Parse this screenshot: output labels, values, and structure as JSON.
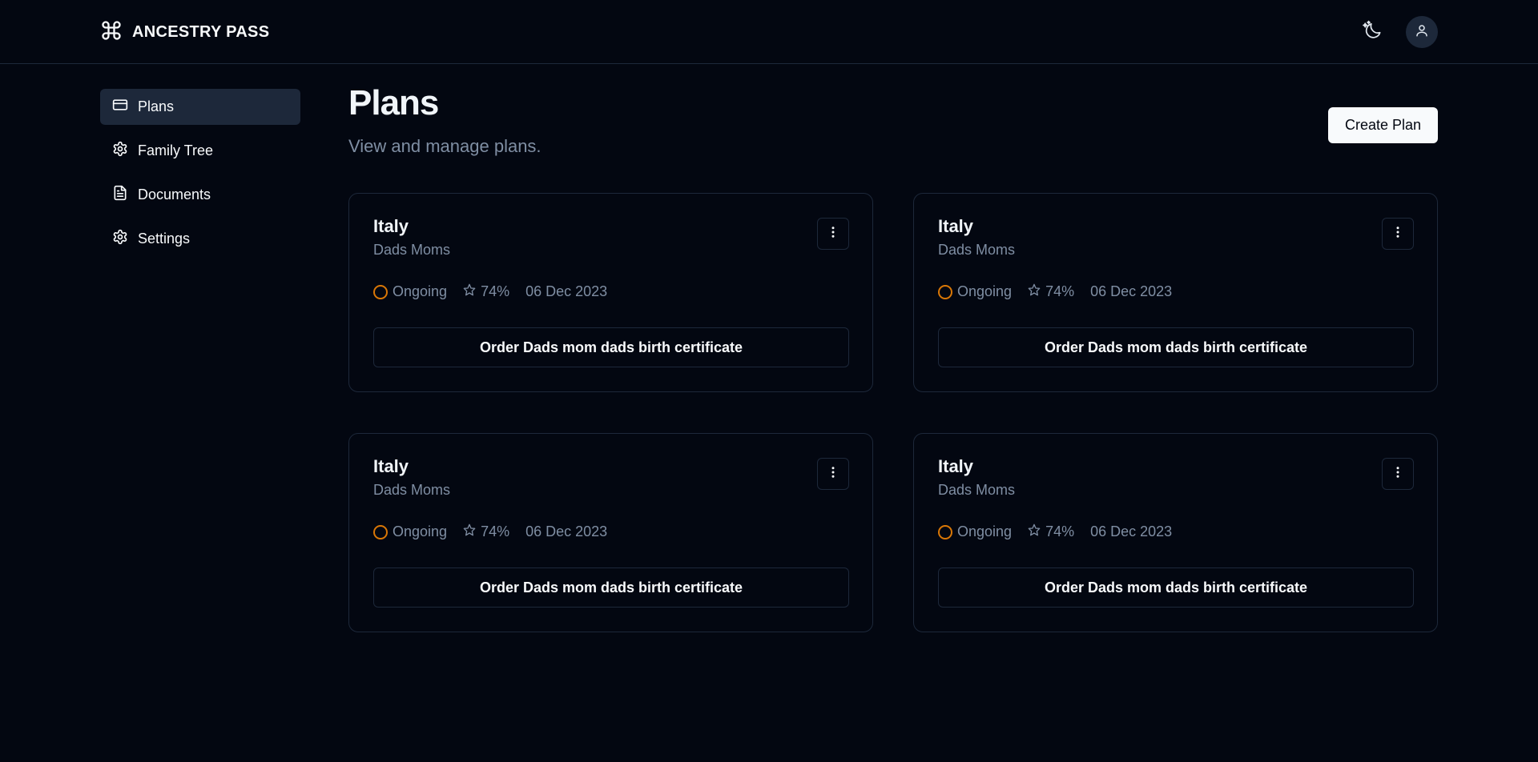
{
  "header": {
    "brand_name": "ANCESTRY PASS"
  },
  "sidebar": {
    "items": [
      {
        "label": "Plans"
      },
      {
        "label": "Family Tree"
      },
      {
        "label": "Documents"
      },
      {
        "label": "Settings"
      }
    ]
  },
  "main": {
    "title": "Plans",
    "subtitle": "View and manage plans.",
    "create_button": "Create Plan"
  },
  "plans": [
    {
      "title": "Italy",
      "subtitle": "Dads Moms",
      "status": "Ongoing",
      "score": "74%",
      "date": "06 Dec 2023",
      "task": "Order Dads mom dads birth certificate"
    },
    {
      "title": "Italy",
      "subtitle": "Dads Moms",
      "status": "Ongoing",
      "score": "74%",
      "date": "06 Dec 2023",
      "task": "Order Dads mom dads birth certificate"
    },
    {
      "title": "Italy",
      "subtitle": "Dads Moms",
      "status": "Ongoing",
      "score": "74%",
      "date": "06 Dec 2023",
      "task": "Order Dads mom dads birth certificate"
    },
    {
      "title": "Italy",
      "subtitle": "Dads Moms",
      "status": "Ongoing",
      "score": "74%",
      "date": "06 Dec 2023",
      "task": "Order Dads mom dads birth certificate"
    }
  ],
  "colors": {
    "background": "#030711",
    "border": "#1d283a",
    "muted_text": "#7f8ea3",
    "status_ongoing": "#d97706"
  }
}
